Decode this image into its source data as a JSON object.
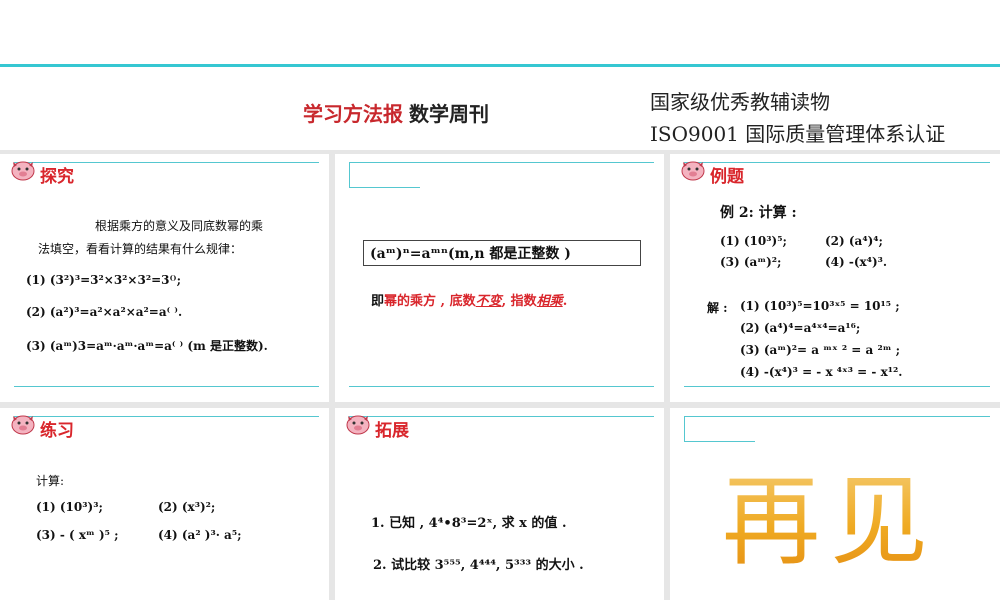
{
  "header": {
    "title_red": "学习方法报",
    "title_black": "数学周刊",
    "cert_line1": "国家级优秀教辅读物",
    "cert_line2": "ISO9001 国际质量管理体系认证"
  },
  "slide1": {
    "label": "探究",
    "intro_line1": "根据乘方的意义及同底数幂的乘",
    "intro_line2": "法填空，看看计算的结果有什么规律：",
    "item1": "(1)  (3²)³=3²×3²×3²=3⁽⁾;",
    "item2": "(2)  (a²)³=a²×a²×a²=a⁽ ⁾.",
    "item3_pre": "(3)  (aᵐ)3=aᵐ·aᵐ·aᵐ=a⁽ ⁾ (m ",
    "item3_bold": "是正整数",
    "item3_post": ")."
  },
  "slide2": {
    "formula": "(aᵐ)ⁿ=aᵐⁿ(m,n 都是正整数 )",
    "rule_pre": "即",
    "rule_red1": "幂的乘方 , 底数",
    "rule_u1": "不变",
    "rule_red2": ", 指数",
    "rule_u2": "相乘",
    "rule_end": "."
  },
  "slide3": {
    "label": "例题",
    "example_title": "例 2: 计算 :",
    "q_row1_a": "(1)  (10³)⁵;",
    "q_row1_b": "(2)     (a⁴)⁴;",
    "q_row2_a": "(3)  (aᵐ)²;",
    "q_row2_b": "(4)     -(x⁴)³.",
    "sol_label": "解 :",
    "sol1": "(1)   (10³)⁵=10³ˣ⁵ = 10¹⁵ ;",
    "sol2": "(2)   (a⁴)⁴=a⁴ˣ⁴=a¹⁶;",
    "sol3": "(3)   (aᵐ)²= a ᵐˣ ² = a ²ᵐ ;",
    "sol4": "(4)   -(x⁴)³ = - x ⁴ˣ³ = - x¹²."
  },
  "slide4": {
    "label": "练习",
    "heading": "计算:",
    "p1": "(1)  (10³)³;",
    "p2": "(2)    (x³)²;",
    "p3": "(3)  - ( xᵐ )⁵ ;",
    "p4": "(4)  (a² )³· a⁵;"
  },
  "slide5": {
    "label": "拓展",
    "q1": "1.  已知 , 4⁴•8³=2ˣ,  求 x 的值 .",
    "q2": "2.  试比较 3⁵⁵⁵, 4⁴⁴⁴, 5³³³ 的大小 ."
  },
  "slide6": {
    "farewell": "再见"
  }
}
